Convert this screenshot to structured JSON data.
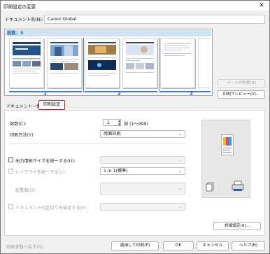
{
  "window": {
    "title": "印刷設定の変更",
    "close_glyph": "✕"
  },
  "document_name": {
    "label": "ドキュメント名(N):",
    "value": "Canon Global"
  },
  "preview": {
    "count_label": "枚数：3",
    "groups": [
      "1",
      "2",
      "3"
    ]
  },
  "side_buttons": {
    "delete_page": "ページの削除(D)",
    "print_preview": "印刷プレビュー(V)..."
  },
  "tabs": {
    "doc_list": "ドキュメント一覧",
    "print_settings": "印刷設定"
  },
  "settings": {
    "copies_label": "部数(C):",
    "copies_value": "1",
    "copies_suffix": "部 (1〜999)",
    "method_label": "印刷方法(Y)",
    "method_value": "両面印刷",
    "unify_paper_label": "出力用紙サイズを統一する(U):",
    "unify_paper_value": "",
    "layout_label": "レイアウトを統一する(L):",
    "layout_value": "1 in 1(標準)",
    "order_label": "配置順(D):",
    "order_value": "",
    "divider_label": "ドキュメントの区切りを設定する(F):",
    "divider_value": "",
    "detail_button": "詳細設定(A)..."
  },
  "footer": {
    "restore": "印刷状態へ戻す(R)",
    "apply_print": "適用して印刷(P)",
    "ok": "OK",
    "cancel": "キャンセル",
    "help": "ヘルプ(H)"
  },
  "colors": {
    "accent": "#3b83c9",
    "highlight_border": "#e11b1b",
    "count_bar": "#cfe3f7"
  }
}
